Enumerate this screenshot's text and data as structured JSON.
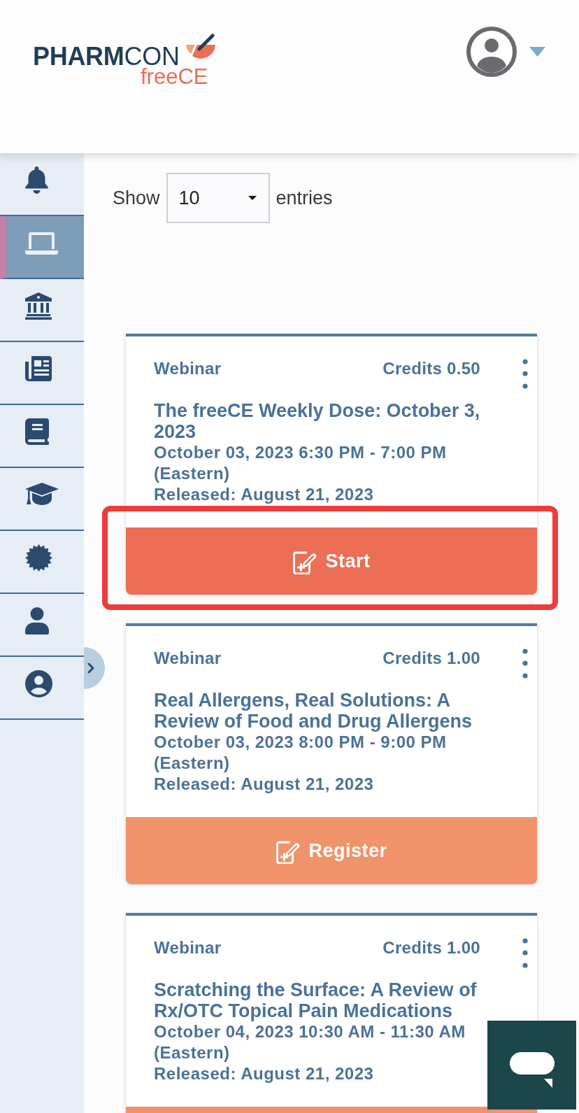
{
  "header": {
    "logo": {
      "wordmark": "**PHARM**CON",
      "tagline": "freeCE"
    }
  },
  "sidebar": {
    "items": [
      {
        "selected": false
      },
      {
        "selected": true
      },
      {
        "selected": false
      },
      {
        "selected": false
      },
      {
        "selected": false
      },
      {
        "selected": false
      },
      {
        "selected": false
      },
      {
        "selected": false
      },
      {
        "selected": false
      }
    ]
  },
  "entries_control": {
    "prefix": "Show",
    "value": "10",
    "suffix": "entries"
  },
  "cards": [
    {
      "type": "Webinar",
      "credits": "Credits 0.50",
      "title": "The freeCE Weekly Dose: October 3, 2023",
      "schedule": "October 03, 2023 6:30 PM - 7:00 PM (Eastern)",
      "released": "Released: August 21, 2023",
      "action": {
        "kind": "primary",
        "label": "Start"
      },
      "highlighted": true
    },
    {
      "type": "Webinar",
      "credits": "Credits 1.00",
      "title": "Real Allergens, Real Solutions: A Review of Food and Drug Allergens",
      "schedule": "October 03, 2023 8:00 PM - 9:00 PM (Eastern)",
      "released": "Released: August 21, 2023",
      "action": {
        "kind": "secondary",
        "label": "Register"
      },
      "highlighted": false
    },
    {
      "type": "Webinar",
      "credits": "Credits 1.00",
      "title": "Scratching the Surface: A Review of Rx/OTC Topical Pain Medications",
      "schedule": "October 04, 2023 10:30 AM - 11:30 AM (Eastern)",
      "released": "Released: August 21, 2023",
      "action": {
        "kind": "secondary"
      },
      "highlighted": false
    }
  ]
}
